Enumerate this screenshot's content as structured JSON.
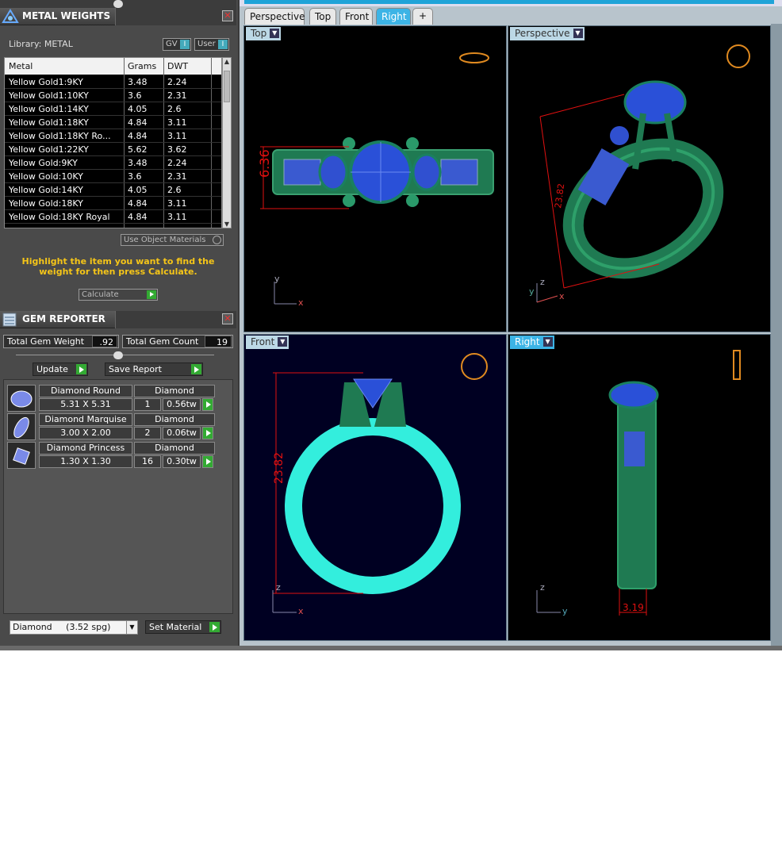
{
  "metal_weights": {
    "title": "METAL WEIGHTS",
    "library_label": "Library: METAL",
    "gv_label": "GV",
    "user_label": "User",
    "columns": [
      "Metal",
      "Grams",
      "DWT"
    ],
    "rows": [
      {
        "metal": "Yellow Gold1:9KY",
        "grams": "3.48",
        "dwt": "2.24"
      },
      {
        "metal": "Yellow Gold1:10KY",
        "grams": "3.6",
        "dwt": "2.31"
      },
      {
        "metal": "Yellow Gold1:14KY",
        "grams": "4.05",
        "dwt": "2.6"
      },
      {
        "metal": "Yellow Gold1:18KY",
        "grams": "4.84",
        "dwt": "3.11"
      },
      {
        "metal": "Yellow Gold1:18KY Ro...",
        "grams": "4.84",
        "dwt": "3.11"
      },
      {
        "metal": "Yellow Gold1:22KY",
        "grams": "5.62",
        "dwt": "3.62"
      },
      {
        "metal": "Yellow Gold:9KY",
        "grams": "3.48",
        "dwt": "2.24"
      },
      {
        "metal": "Yellow Gold:10KY",
        "grams": "3.6",
        "dwt": "2.31"
      },
      {
        "metal": "Yellow Gold:14KY",
        "grams": "4.05",
        "dwt": "2.6"
      },
      {
        "metal": "Yellow Gold:18KY",
        "grams": "4.84",
        "dwt": "3.11"
      },
      {
        "metal": "Yellow Gold:18KY Royal",
        "grams": "4.84",
        "dwt": "3.11"
      }
    ],
    "use_object_materials": "Use Object Materials",
    "instruction": "Highlight the item you want to find the weight for then press Calculate.",
    "calculate_label": "Calculate"
  },
  "gem_reporter": {
    "title": "GEM REPORTER",
    "total_weight_label": "Total Gem Weight",
    "total_weight_value": ".92",
    "total_count_label": "Total Gem Count",
    "total_count_value": "19",
    "update_label": "Update",
    "save_report_label": "Save Report",
    "gems": [
      {
        "shape": "Diamond Round",
        "material": "Diamond",
        "size": "5.31 X 5.31",
        "count": "1",
        "weight": "0.56tw"
      },
      {
        "shape": "Diamond Marquise",
        "material": "Diamond",
        "size": "3.00 X 2.00",
        "count": "2",
        "weight": "0.06tw"
      },
      {
        "shape": "Diamond Princess",
        "material": "Diamond",
        "size": "1.30 X 1.30",
        "count": "16",
        "weight": "0.30tw"
      }
    ],
    "material_select": "Diamond     (3.52 spg)",
    "set_material_label": "Set Material"
  },
  "viewport_tabs": [
    "Perspective",
    "Top",
    "Front",
    "Right"
  ],
  "active_tab": "Right",
  "add_tab_icon": "+",
  "viewports": {
    "top": {
      "label": "Top",
      "dimension": "6.36",
      "axis_a": "y",
      "axis_b": "x"
    },
    "perspective": {
      "label": "Perspective",
      "dimension": "23.82",
      "axis_a": "z",
      "axis_b": "x",
      "axis_c": "y"
    },
    "front": {
      "label": "Front",
      "dimension": "23.82",
      "axis_a": "z",
      "axis_b": "x"
    },
    "right": {
      "label": "Right",
      "dimension": "3.19",
      "axis_a": "z",
      "axis_b": "y"
    }
  },
  "colors": {
    "ring_green": "#1f7a52",
    "ring_cyan": "#33eedd",
    "gem_blue": "#2a50d8",
    "dim_red": "#e01010",
    "accent": "#1fa3d8"
  }
}
